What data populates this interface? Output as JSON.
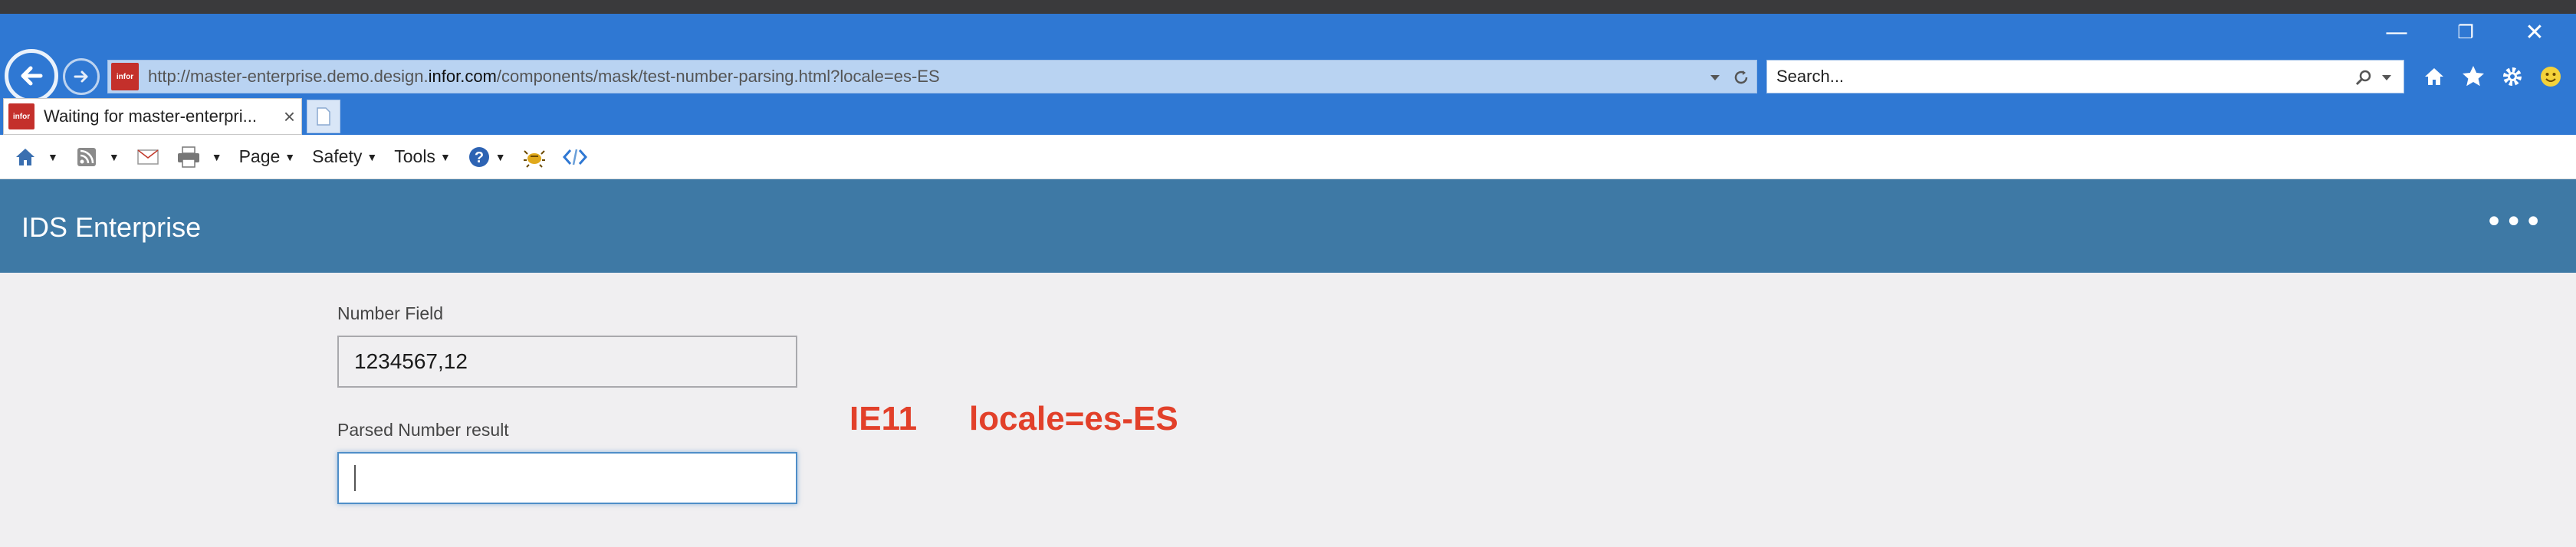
{
  "browser": {
    "url_prefix": "http://master-enterprise.demo.design.",
    "url_domain": "infor.com",
    "url_suffix": "/components/mask/test-number-parsing.html?locale=es-ES",
    "search_placeholder": "Search...",
    "tab_title": "Waiting for master-enterpri...",
    "favicon_text": "infor",
    "window_buttons": [
      "—",
      "❐",
      "✕"
    ],
    "commands": {
      "page": "Page",
      "safety": "Safety",
      "tools": "Tools"
    }
  },
  "app": {
    "title": "IDS Enterprise",
    "more_label": "•••"
  },
  "form": {
    "number_field_label": "Number Field",
    "number_field_value": "1234567,12",
    "parsed_label": "Parsed Number result",
    "parsed_value": ""
  },
  "annotations": {
    "browser_tag": "IE11",
    "locale_tag": "locale=es-ES"
  },
  "colors": {
    "chrome_blue": "#2f78d3",
    "header_blue": "#3e79a5",
    "annotation_red": "#e2402a"
  }
}
